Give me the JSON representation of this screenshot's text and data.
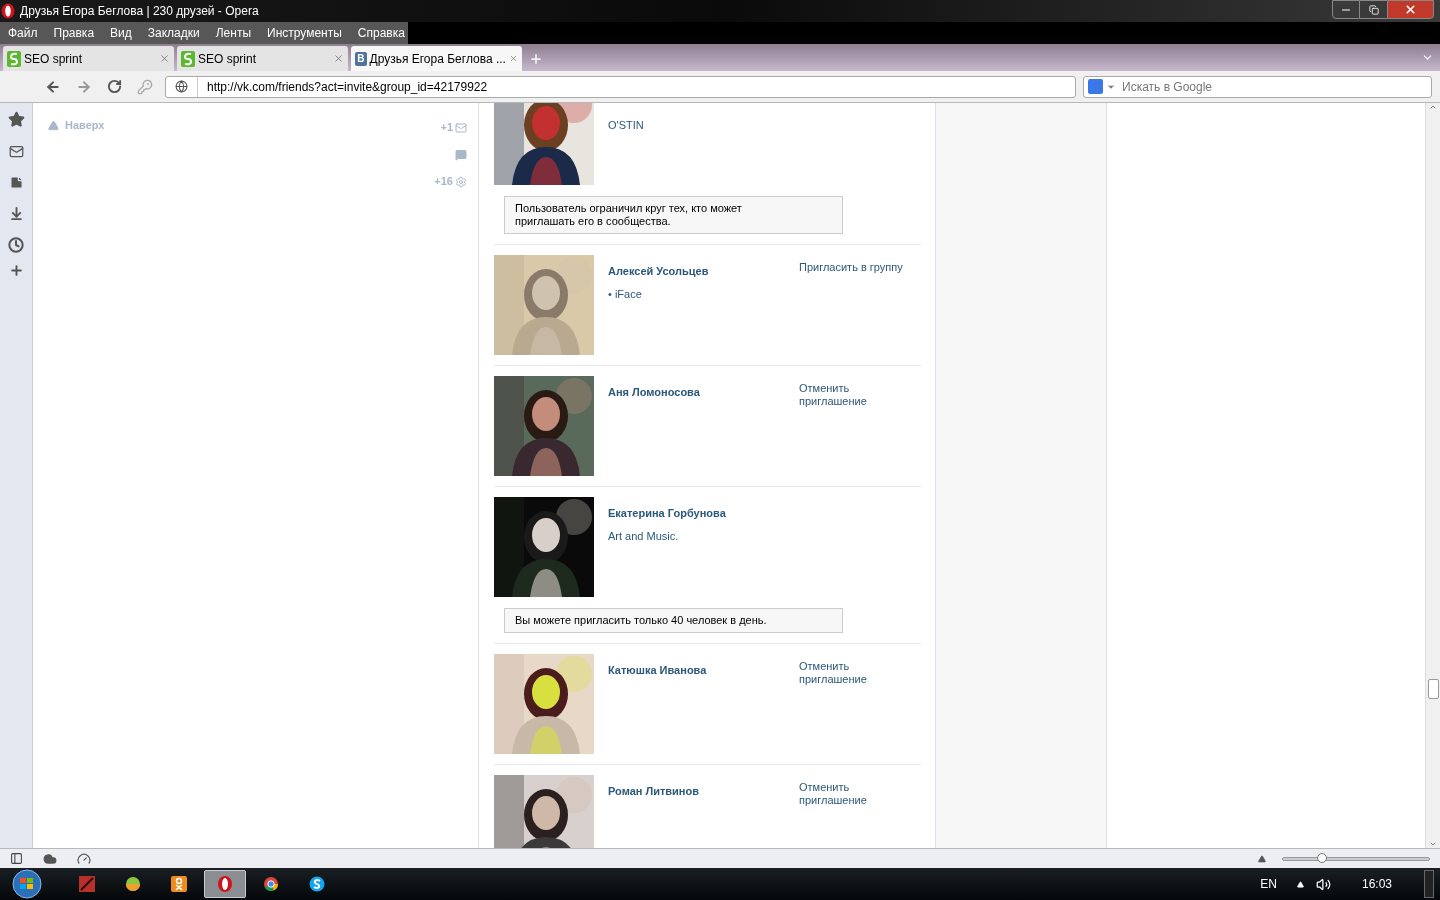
{
  "window": {
    "title": "Друзья Егора Беглова | 230 друзей - Opera"
  },
  "menu": [
    "Файл",
    "Правка",
    "Вид",
    "Закладки",
    "Ленты",
    "Инструменты",
    "Справка"
  ],
  "tabs": [
    {
      "label": "SEO sprint",
      "selected": false,
      "kind": "seo"
    },
    {
      "label": "SEO sprint",
      "selected": false,
      "kind": "seo"
    },
    {
      "label": "Друзья Егора Беглова ...",
      "selected": true,
      "kind": "vk",
      "badge": "В"
    }
  ],
  "address": {
    "url": "http://vk.com/friends?act=invite&group_id=42179922"
  },
  "search": {
    "placeholder": "Искать в Google"
  },
  "page": {
    "back_link": "Наверх",
    "counters": [
      {
        "kind": "mail",
        "count": "+1"
      },
      {
        "kind": "chat"
      },
      {
        "kind": "settings",
        "count": "+16"
      }
    ]
  },
  "friends": [
    {
      "subtitle": "O'STIN",
      "notice": "Пользователь ограничил круг тех, кто может приглашать его в сообщества."
    },
    {
      "name": "Алексей Усольцев",
      "subtitle": "• iFace",
      "action": "Пригласить в группу"
    },
    {
      "name": "Аня Ломоносова",
      "action": "Отменить приглашение"
    },
    {
      "name": "Екатерина Горбунова",
      "subtitle": "Art and Music.",
      "notice": "Вы можете пригласить только 40 человек в день."
    },
    {
      "name": "Катюшка Иванова",
      "action": "Отменить приглашение"
    },
    {
      "name": "Роман Литвинов",
      "action": "Отменить приглашение"
    }
  ],
  "status_bar": {
    "zoom": {
      "level": 0.27
    }
  },
  "taskbar": {
    "apps": [
      {
        "kind": "red",
        "selected": false
      },
      {
        "kind": "ball",
        "selected": false
      },
      {
        "kind": "ok",
        "selected": false
      },
      {
        "kind": "opera",
        "selected": true
      },
      {
        "kind": "chrome",
        "selected": false
      },
      {
        "kind": "skype",
        "selected": false
      }
    ],
    "language": "EN",
    "time": "16:03"
  }
}
